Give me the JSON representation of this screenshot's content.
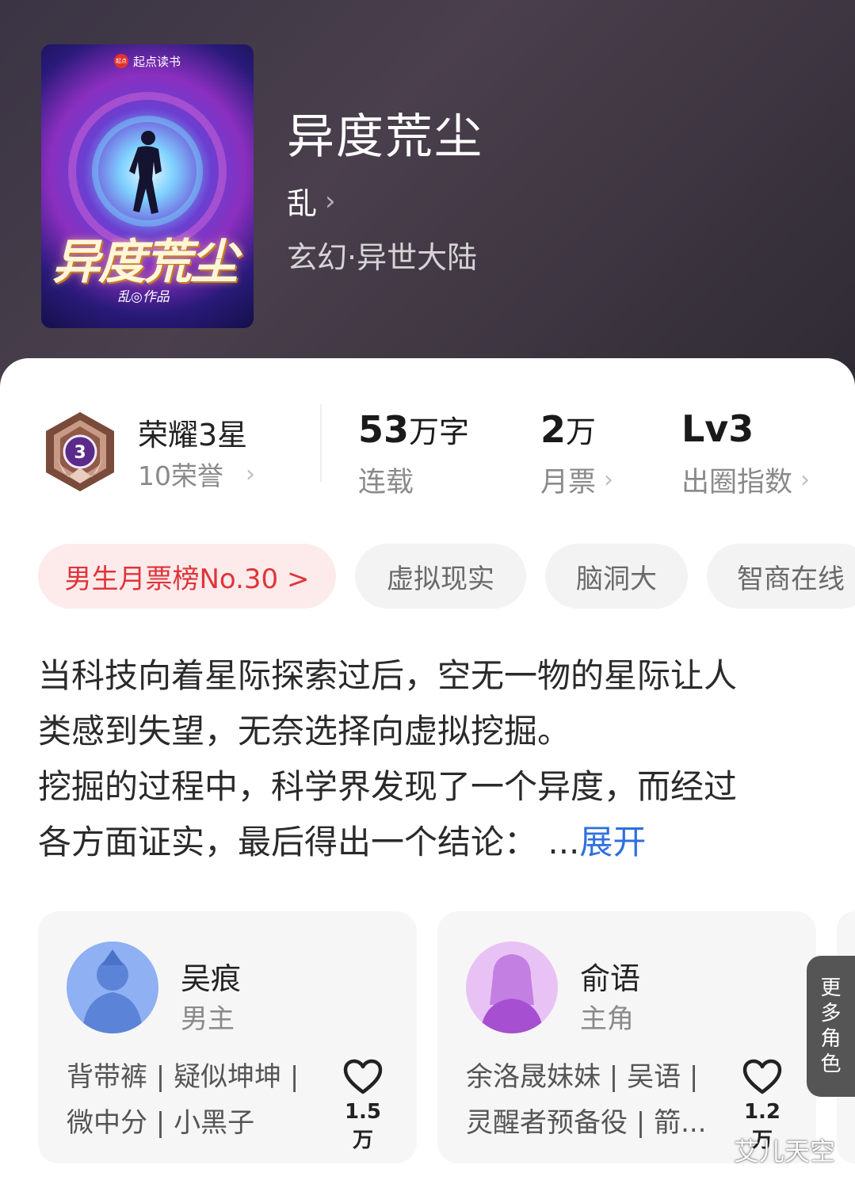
{
  "cover": {
    "brand": "起点读书",
    "brand_mark": "起点",
    "title": "异度荒尘",
    "author_line": "乱◎作品"
  },
  "book": {
    "title": "异度荒尘",
    "author": "乱",
    "genre": "玄幻·异世大陆"
  },
  "honor": {
    "level_number": "3",
    "title": "荣耀3星",
    "sub": "10荣誉"
  },
  "stats": [
    {
      "value": "53",
      "unit": "万字",
      "label": "连载"
    },
    {
      "value": "2",
      "unit": "万",
      "label": "月票"
    },
    {
      "value": "Lv3",
      "unit": "",
      "label": "出圈指数"
    }
  ],
  "tags": [
    "男生月票榜No.30 >",
    "虚拟现实",
    "脑洞大",
    "智商在线"
  ],
  "synopsis": {
    "lines": [
      "当科技向着星际探索过后，空无一物的星际让人",
      "类感到失望，无奈选择向虚拟挖掘。",
      "挖掘的过程中，科学界发现了一个异度，而经过",
      "各方面证实，最后得出一个结论：  ..."
    ],
    "expand": "展开"
  },
  "characters": [
    {
      "name": "吴痕",
      "role": "男主",
      "tags": [
        "背带裤 | 疑似坤坤 |",
        "微中分 | 小黑子"
      ],
      "likes": "1.5万"
    },
    {
      "name": "俞语",
      "role": "主角",
      "tags": [
        "余洛晟妹妹 | 吴语 |",
        "灵醒者预备役 | 箭..."
      ],
      "likes": "1.2万"
    }
  ],
  "more_roles": [
    "更",
    "多",
    "角",
    "色"
  ],
  "watermark": "艾儿天空",
  "colors": {
    "accent_red": "#e0343a",
    "link_blue": "#2f6fe0",
    "header_bg": "#3d3540"
  },
  "icons": {
    "chevron": "chevron-right-icon",
    "heart": "heart-icon",
    "badge": "honor-badge-icon"
  }
}
